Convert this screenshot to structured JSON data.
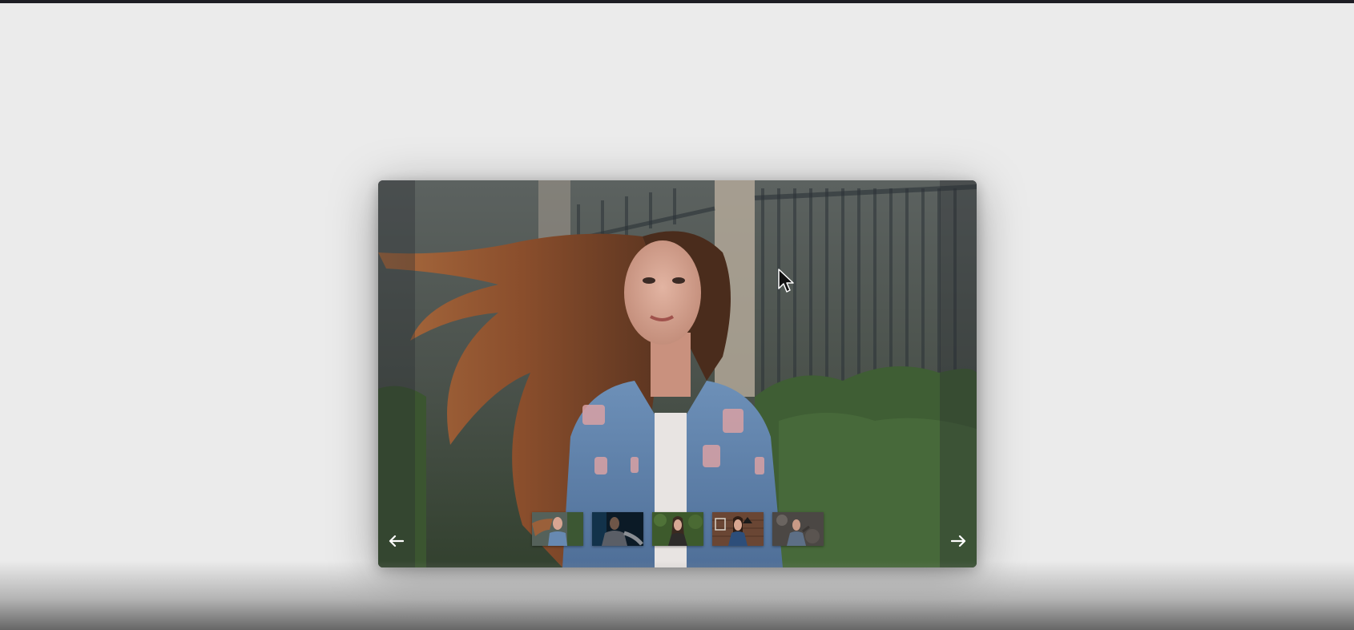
{
  "slider": {
    "current_slide": 1,
    "slide_count": 5,
    "image_label": "woman-denim-jacket-hair-blowing",
    "prev_icon": "arrow-left-icon",
    "next_icon": "arrow-right-icon",
    "arrow_color": "#ffffff"
  },
  "thumbnails": [
    {
      "image_label": "woman-denim-jacket",
      "active": true
    },
    {
      "image_label": "man-dark-background",
      "active": false
    },
    {
      "image_label": "woman-greenery",
      "active": false
    },
    {
      "image_label": "woman-brick-wall-lamp",
      "active": false
    },
    {
      "image_label": "man-rocky-background",
      "active": false
    }
  ],
  "colors": {
    "page_background": "#ebebeb",
    "top_bar": "#1e1e24"
  }
}
